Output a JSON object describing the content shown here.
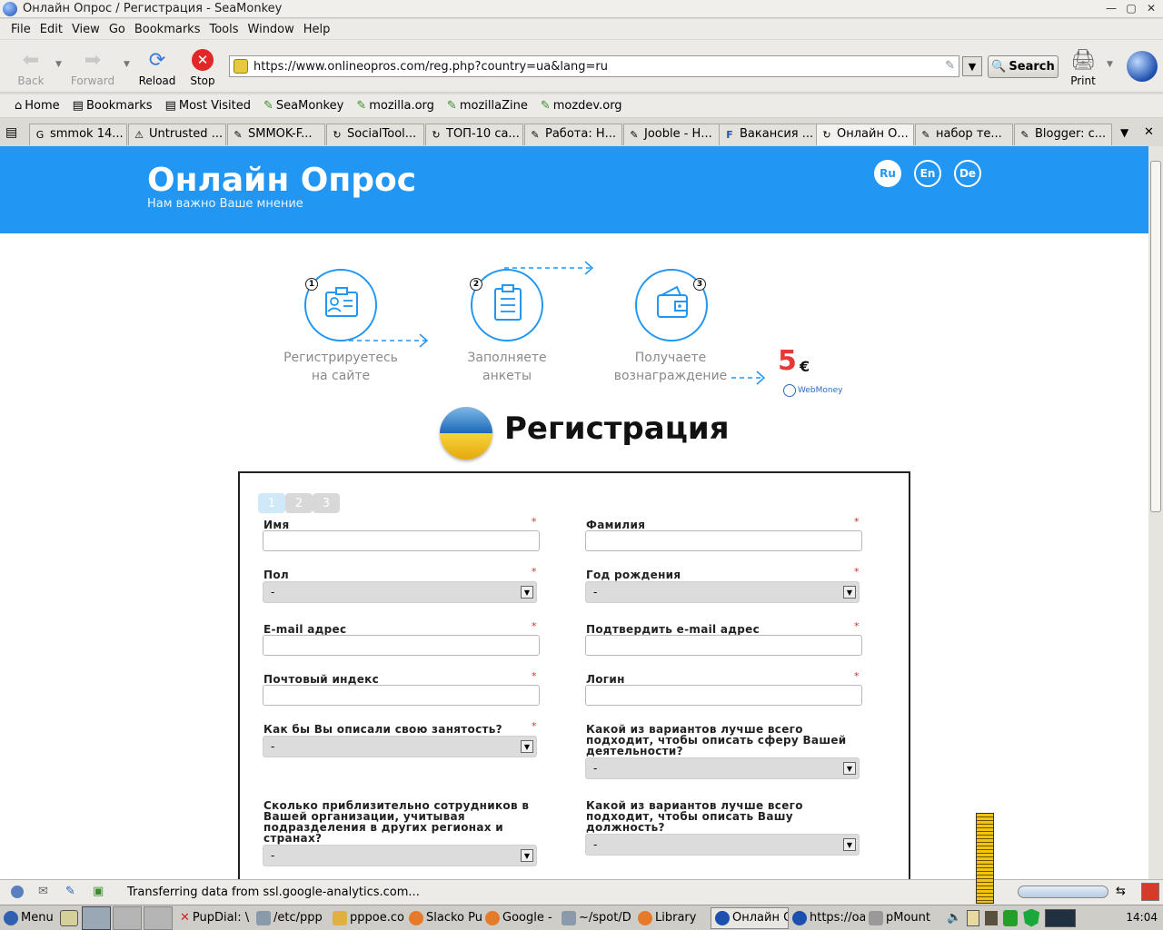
{
  "window": {
    "title": "Онлайн Опрос / Регистрация - SeaMonkey",
    "controls": [
      "—",
      "▢",
      "✕"
    ]
  },
  "menu": [
    "File",
    "Edit",
    "View",
    "Go",
    "Bookmarks",
    "Tools",
    "Window",
    "Help"
  ],
  "toolbar": {
    "back": "Back",
    "forward": "Forward",
    "reload": "Reload",
    "stop": "Stop",
    "print": "Print",
    "search": "Search"
  },
  "url": "https://www.onlineopros.com/reg.php?country=ua&lang=ru",
  "bookmarks": [
    "Home",
    "Bookmarks",
    "Most Visited",
    "SeaMonkey",
    "mozilla.org",
    "mozillaZine",
    "mozdev.org"
  ],
  "tabs": [
    {
      "label": "smmok 14...",
      "icon": "G"
    },
    {
      "label": "Untrusted ...",
      "icon": "⚠"
    },
    {
      "label": "SMMOK-F...",
      "icon": "✎"
    },
    {
      "label": "SocialTool...",
      "icon": "↻"
    },
    {
      "label": "ТОП-10 са...",
      "icon": "↻"
    },
    {
      "label": "Работа: Н...",
      "icon": "✎"
    },
    {
      "label": "Jooble - Н...",
      "icon": "✎"
    },
    {
      "label": "Вакансия ...",
      "icon": "F"
    },
    {
      "label": "Онлайн О...",
      "icon": "↻"
    },
    {
      "label": "набор те...",
      "icon": "✎"
    },
    {
      "label": "Blogger: с...",
      "icon": "✎"
    }
  ],
  "site": {
    "title": "Онлайн Опрос",
    "subtitle": "Нам важно Ваше мнение",
    "langs": [
      "Ru",
      "En",
      "De"
    ],
    "steps": [
      {
        "num": "1",
        "line1": "Регистрируетесь",
        "line2": "на сайте"
      },
      {
        "num": "2",
        "line1": "Заполняете",
        "line2": "анкеты"
      },
      {
        "num": "3",
        "line1": "Получаете",
        "line2": "вознаграждение"
      }
    ],
    "reward_amount": "5",
    "reward_currency": "€",
    "reward_brand": "WebMoney",
    "reg_title": "Регистрация"
  },
  "form": {
    "steps": [
      "1",
      "2",
      "3"
    ],
    "required_mark": "*",
    "select_placeholder": "-",
    "fields": {
      "first_name": "Имя",
      "last_name": "Фамилия",
      "gender": "Пол",
      "birth_year": "Год рождения",
      "email": "E-mail адрес",
      "email_confirm": "Подтвердить e-mail адрес",
      "postcode": "Почтовый индекс",
      "login": "Логин",
      "occupation": "Как бы Вы описали свою занятость?",
      "sphere_l1": "Какой из вариантов лучше всего",
      "sphere_l2": "подходит, чтобы описать сферу Вашей",
      "sphere_l3": "деятельности?",
      "employees_l1": "Сколько приблизительно сотрудников в",
      "employees_l2": "Вашей организации, учитывая",
      "employees_l3": "подразделения в других регионах и",
      "employees_l4": "странах?",
      "position_l1": "Какой из вариантов лучше всего",
      "position_l2": "подходит, чтобы описать Вашу",
      "position_l3": "должность?"
    }
  },
  "status": "Transferring data from ssl.google-analytics.com...",
  "taskbar": {
    "items": [
      "Menu",
      "PupDial: \\",
      "/etc/ppp",
      "pppoe.co",
      "Slacko Pu",
      "Google -",
      "~/spot/D",
      "Library",
      "Онлайн О",
      "https://oa",
      "pMount"
    ],
    "clock": "14:04"
  }
}
